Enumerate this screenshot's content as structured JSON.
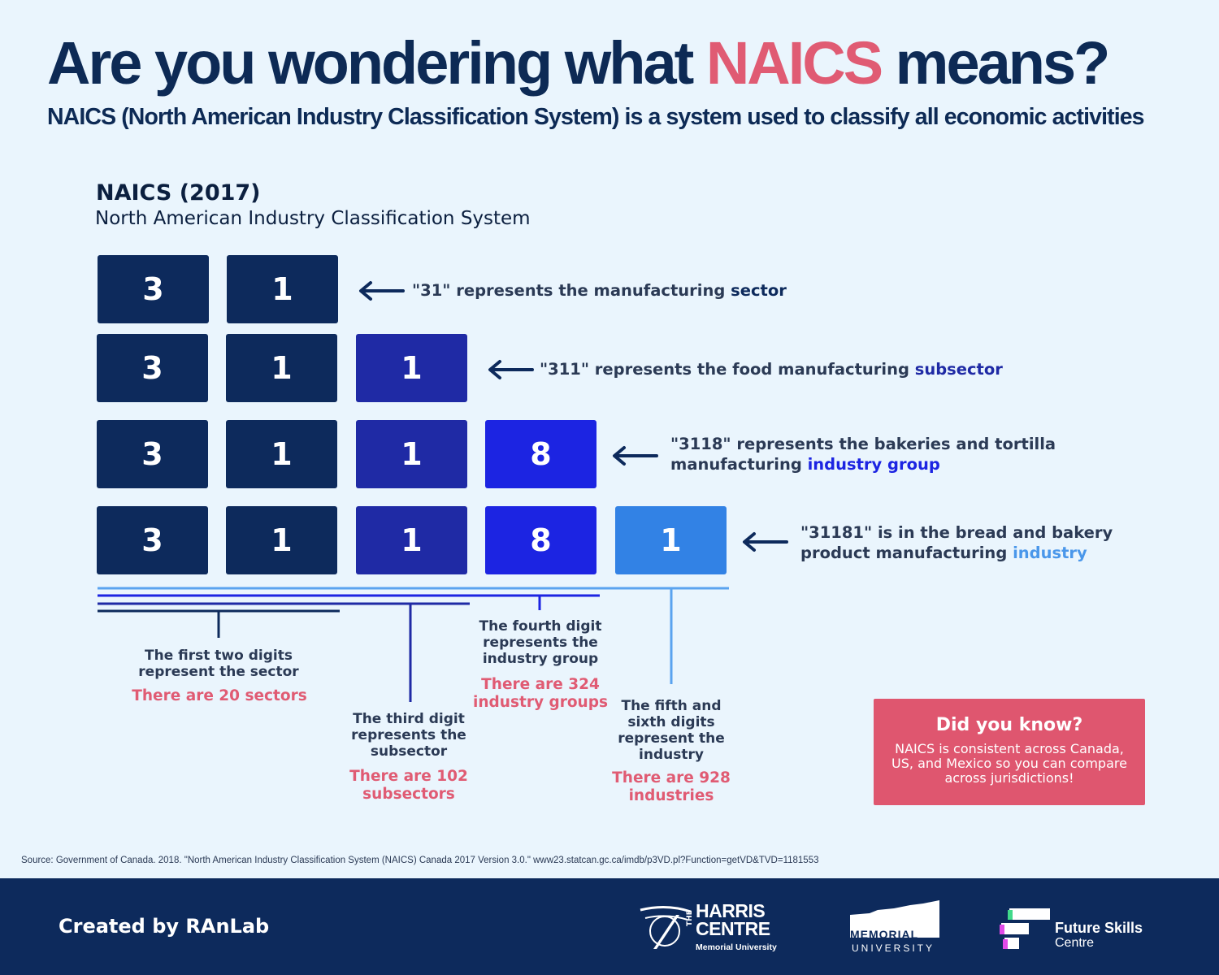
{
  "header": {
    "title_prefix": "Are you wondering what ",
    "title_highlight": "NAICS",
    "title_suffix": " means?",
    "subtitle": "NAICS (North American Industry Classification System) is a system used to classify all economic activities"
  },
  "naics": {
    "heading": "NAICS (2017)",
    "subheading": "North American Industry Classification System"
  },
  "rows": [
    {
      "digits": [
        "3",
        "1"
      ],
      "desc_prefix": "\"31\" represents the manufacturing ",
      "desc_keyword": "sector"
    },
    {
      "digits": [
        "3",
        "1",
        "1"
      ],
      "desc_prefix": "\"311\" represents the food manufacturing ",
      "desc_keyword": "subsector"
    },
    {
      "digits": [
        "3",
        "1",
        "1",
        "8"
      ],
      "desc_line1": "\"3118\" represents the bakeries and tortilla",
      "desc_prefix": "manufacturing ",
      "desc_keyword": "industry group"
    },
    {
      "digits": [
        "3",
        "1",
        "1",
        "8",
        "1"
      ],
      "desc_line1": "\"31181\" is in the bread and bakery",
      "desc_prefix": "product manufacturing ",
      "desc_keyword": "industry"
    }
  ],
  "notes": {
    "sector": {
      "text": "The first two digits represent the sector",
      "count": "There are 20 sectors"
    },
    "subsector": {
      "text": "The third digit represents the subsector",
      "count": "There are 102 subsectors"
    },
    "industry_group": {
      "text": "The fourth digit represents the industry group",
      "count": "There are 324 industry groups"
    },
    "industry": {
      "text": "The fifth and sixth digits represent the industry",
      "count": "There are 928 industries"
    }
  },
  "did_you_know": {
    "title": "Did you know?",
    "text": "NAICS is consistent across Canada, US, and Mexico so you can compare across jurisdictions!"
  },
  "source": "Source: Government of Canada. 2018. \"North American Industry Classification System (NAICS) Canada 2017 Version 3.0.\" www23.statcan.gc.ca/imdb/p3VD.pl?Function=getVD&TVD=1181553",
  "footer": {
    "created_by": "Created by RAnLab",
    "logos": {
      "harris_top": "THE",
      "harris_name1": "HARRIS",
      "harris_name2": "CENTRE",
      "harris_sub": "Memorial University",
      "memorial_name": "MEMORIAL",
      "memorial_sub": "UNIVERSITY",
      "fsc_name1": "Future Skills",
      "fsc_name2": "Centre"
    }
  },
  "colors": {
    "navy": "#0d2a5c",
    "indigo": "#1f2aa5",
    "blue": "#1c24e2",
    "light_blue": "#3282e5",
    "pink": "#e05b73",
    "background": "#eaf5fd"
  }
}
